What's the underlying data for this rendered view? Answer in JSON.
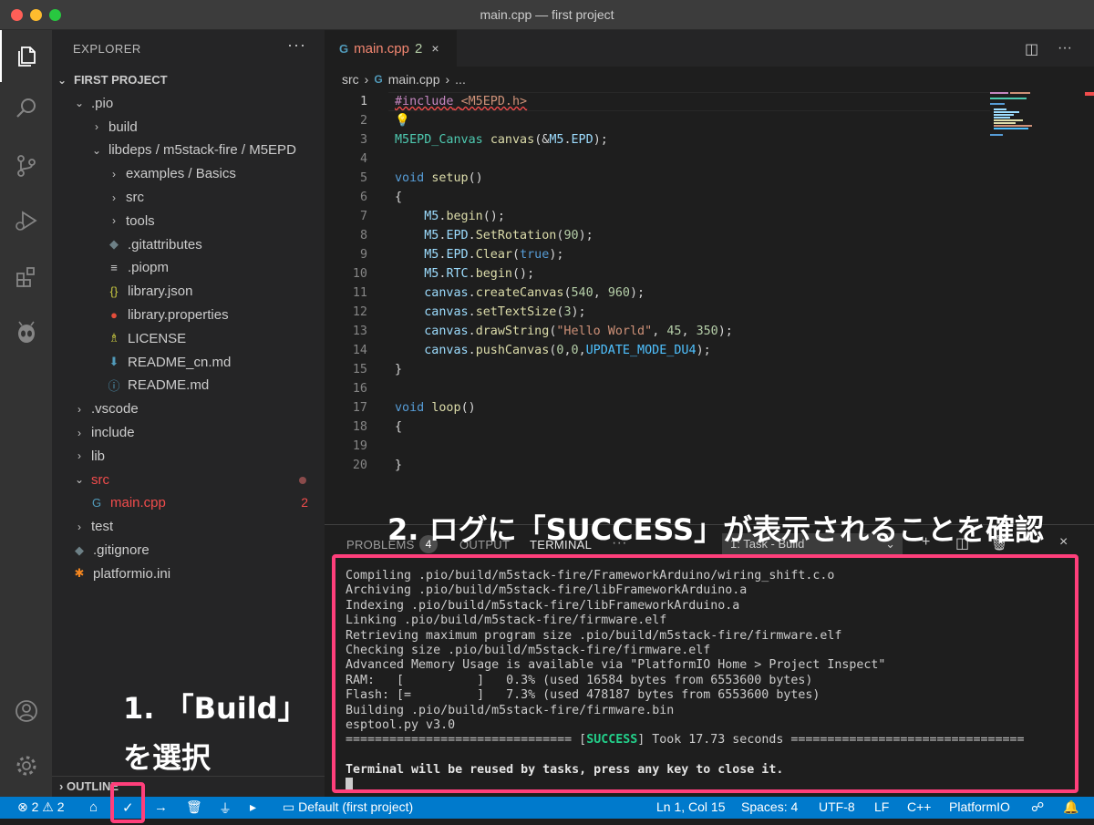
{
  "window": {
    "title": "main.cpp — first project"
  },
  "explorer": {
    "header": "EXPLORER",
    "more": "···",
    "rows": [
      {
        "indent": 0,
        "chev": "⌄",
        "icon": "",
        "label": "FIRST PROJECT",
        "section": true
      },
      {
        "indent": 1,
        "chev": "⌄",
        "icon": "",
        "label": ".pio"
      },
      {
        "indent": 2,
        "chev": "›",
        "icon": "",
        "label": "build"
      },
      {
        "indent": 2,
        "chev": "⌄",
        "icon": "",
        "label": "libdeps / m5stack-fire / M5EPD"
      },
      {
        "indent": 3,
        "chev": "›",
        "icon": "",
        "label": "examples / Basics"
      },
      {
        "indent": 3,
        "chev": "›",
        "icon": "",
        "label": "src"
      },
      {
        "indent": 3,
        "chev": "›",
        "icon": "",
        "label": "tools"
      },
      {
        "indent": 3,
        "chev": "",
        "icon": "◆",
        "iconColor": "#6d8086",
        "label": ".gitattributes"
      },
      {
        "indent": 3,
        "chev": "",
        "icon": "≡",
        "iconColor": "#cccccc",
        "label": ".piopm"
      },
      {
        "indent": 3,
        "chev": "",
        "icon": "{}",
        "iconColor": "#cbcb41",
        "label": "library.json"
      },
      {
        "indent": 3,
        "chev": "",
        "icon": "●",
        "iconColor": "#e44d3a",
        "label": "library.properties"
      },
      {
        "indent": 3,
        "chev": "",
        "icon": "♗",
        "iconColor": "#cbcb41",
        "label": "LICENSE"
      },
      {
        "indent": 3,
        "chev": "",
        "icon": "⬇",
        "iconColor": "#519aba",
        "label": "README_cn.md"
      },
      {
        "indent": 3,
        "chev": "",
        "icon": "ⓘ",
        "iconColor": "#519aba",
        "label": "README.md"
      },
      {
        "indent": 1,
        "chev": "›",
        "icon": "",
        "label": ".vscode"
      },
      {
        "indent": 1,
        "chev": "›",
        "icon": "",
        "label": "include"
      },
      {
        "indent": 1,
        "chev": "›",
        "icon": "",
        "label": "lib"
      },
      {
        "indent": 1,
        "chev": "⌄",
        "icon": "",
        "label": "src",
        "red": true,
        "dot": true
      },
      {
        "indent": 2,
        "chev": "",
        "icon": "G",
        "iconColor": "#519aba",
        "label": "main.cpp",
        "red": true,
        "count": "2"
      },
      {
        "indent": 1,
        "chev": "›",
        "icon": "",
        "label": "test"
      },
      {
        "indent": 1,
        "chev": "",
        "icon": "◆",
        "iconColor": "#6d8086",
        "label": ".gitignore"
      },
      {
        "indent": 1,
        "chev": "",
        "icon": "✱",
        "iconColor": "#f5871f",
        "label": "platformio.ini"
      }
    ],
    "outline": "OUTLINE"
  },
  "tab": {
    "label": "main.cpp",
    "problems": "2",
    "close": "×"
  },
  "breadcrumb": {
    "root": "src",
    "file": "main.cpp",
    "more": "..."
  },
  "code": [
    {
      "n": "1",
      "html": "<span class=\"kw squig\">#include</span><span class=\"squig\"> </span><span class=\"str squig\">&lt;M5EPD.h&gt;</span>"
    },
    {
      "n": "2",
      "html": "<span style=\"color:#ffcc00\">💡</span>"
    },
    {
      "n": "3",
      "html": "<span class=\"typ\">M5EPD_Canvas</span> <span class=\"fn\">canvas</span>(&amp;<span class=\"var\">M5</span>.<span class=\"var\">EPD</span>);"
    },
    {
      "n": "4",
      "html": ""
    },
    {
      "n": "5",
      "html": "<span class=\"blue\">void</span> <span class=\"fn\">setup</span>()"
    },
    {
      "n": "6",
      "html": "{"
    },
    {
      "n": "7",
      "html": "    <span class=\"var\">M5</span>.<span class=\"fn\">begin</span>();"
    },
    {
      "n": "8",
      "html": "    <span class=\"var\">M5</span>.<span class=\"var\">EPD</span>.<span class=\"fn\">SetRotation</span>(<span class=\"num\">90</span>);"
    },
    {
      "n": "9",
      "html": "    <span class=\"var\">M5</span>.<span class=\"var\">EPD</span>.<span class=\"fn\">Clear</span>(<span class=\"blue\">true</span>);"
    },
    {
      "n": "10",
      "html": "    <span class=\"var\">M5</span>.<span class=\"var\">RTC</span>.<span class=\"fn\">begin</span>();"
    },
    {
      "n": "11",
      "html": "    <span class=\"var\">canvas</span>.<span class=\"fn\">createCanvas</span>(<span class=\"num\">540</span>, <span class=\"num\">960</span>);"
    },
    {
      "n": "12",
      "html": "    <span class=\"var\">canvas</span>.<span class=\"fn\">setTextSize</span>(<span class=\"num\">3</span>);"
    },
    {
      "n": "13",
      "html": "    <span class=\"var\">canvas</span>.<span class=\"fn\">drawString</span>(<span class=\"str\">\"Hello World\"</span>, <span class=\"num\">45</span>, <span class=\"num\">350</span>);"
    },
    {
      "n": "14",
      "html": "    <span class=\"var\">canvas</span>.<span class=\"fn\">pushCanvas</span>(<span class=\"num\">0</span>,<span class=\"num\">0</span>,<span class=\"const\">UPDATE_MODE_DU4</span>);"
    },
    {
      "n": "15",
      "html": "}"
    },
    {
      "n": "16",
      "html": ""
    },
    {
      "n": "17",
      "html": "<span class=\"blue\">void</span> <span class=\"fn\">loop</span>()"
    },
    {
      "n": "18",
      "html": "{"
    },
    {
      "n": "19",
      "html": ""
    },
    {
      "n": "20",
      "html": "}"
    }
  ],
  "panel": {
    "tabs": [
      "PROBLEMS",
      "OUTPUT",
      "TERMINAL"
    ],
    "problems_count": "4",
    "more": "···",
    "task": "1: Task - Build",
    "terminal": [
      "Compiling .pio/build/m5stack-fire/FrameworkArduino/wiring_shift.c.o",
      "Archiving .pio/build/m5stack-fire/libFrameworkArduino.a",
      "Indexing .pio/build/m5stack-fire/libFrameworkArduino.a",
      "Linking .pio/build/m5stack-fire/firmware.elf",
      "Retrieving maximum program size .pio/build/m5stack-fire/firmware.elf",
      "Checking size .pio/build/m5stack-fire/firmware.elf",
      "Advanced Memory Usage is available via \"PlatformIO Home > Project Inspect\"",
      "RAM:   [          ]   0.3% (used 16584 bytes from 6553600 bytes)",
      "Flash: [=         ]   7.3% (used 478187 bytes from 6553600 bytes)",
      "Building .pio/build/m5stack-fire/firmware.bin",
      "esptool.py v3.0"
    ],
    "success_left": "=============================== [",
    "success_word": "SUCCESS",
    "success_right": "] Took 17.73 seconds ================================",
    "reuse": "Terminal will be reused by tasks, press any key to close it."
  },
  "status": {
    "errors": "⊗ 2 ⚠ 2",
    "env": "Default (first project)",
    "pos": "Ln 1, Col 15",
    "spaces": "Spaces: 4",
    "enc": "UTF-8",
    "eol": "LF",
    "lang": "C++",
    "pio": "PlatformIO"
  },
  "annotations": {
    "step1a": "1. 「Build」",
    "step1b": "を選択",
    "step2": "2. ログに「SUCCESS」が表示されることを確認"
  }
}
